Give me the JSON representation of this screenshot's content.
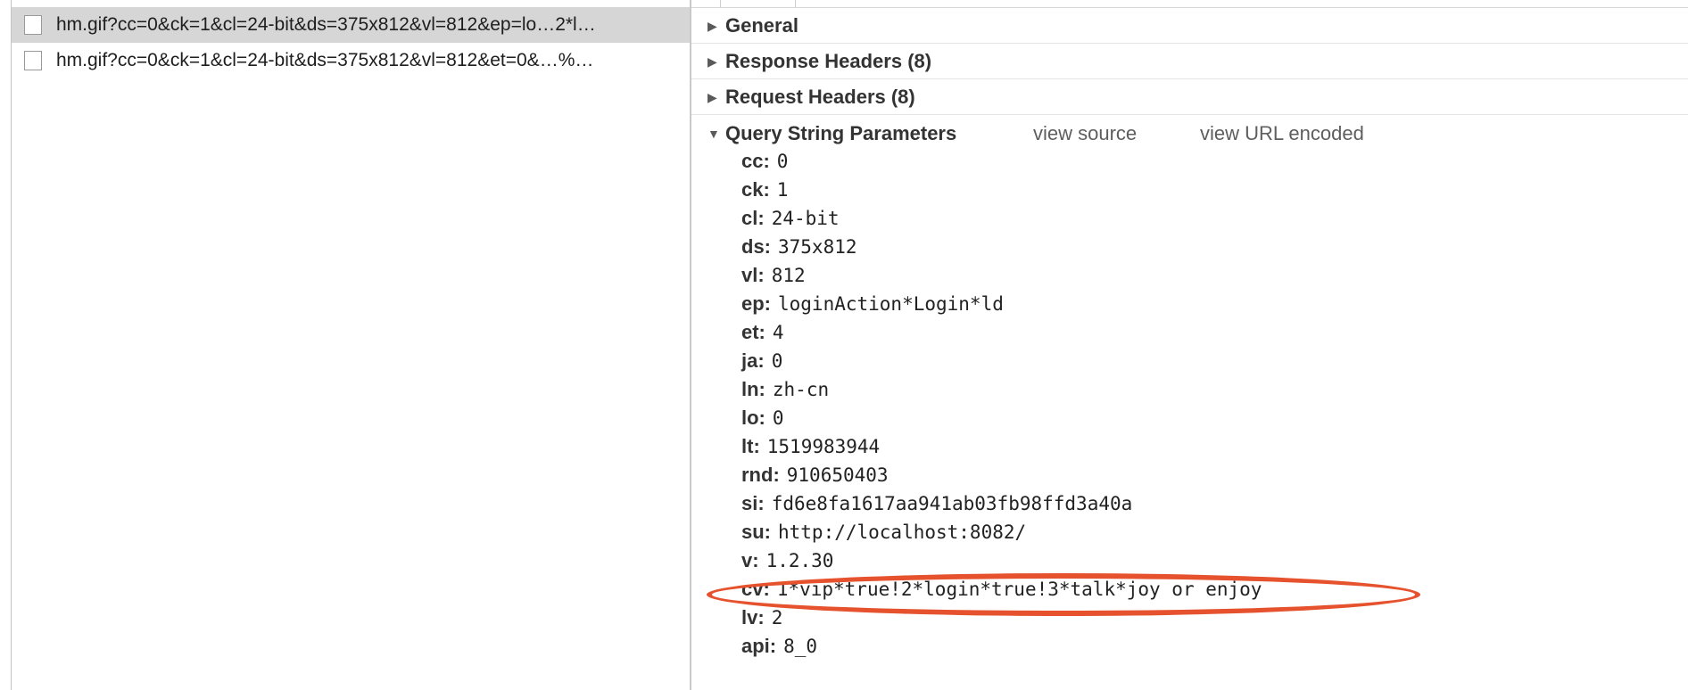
{
  "requests": [
    {
      "name": "hm.gif?cc=0&ck=1&cl=24-bit&ds=375x812&vl=812&ep=lo…2*l…",
      "selected": true
    },
    {
      "name": "hm.gif?cc=0&ck=1&cl=24-bit&ds=375x812&vl=812&et=0&…%…",
      "selected": false
    }
  ],
  "sections": {
    "general": {
      "arrow": "▶",
      "title": "General"
    },
    "response_headers": {
      "arrow": "▶",
      "title": "Response Headers (8)"
    },
    "request_headers": {
      "arrow": "▶",
      "title": "Request Headers (8)"
    },
    "query_string": {
      "arrow": "▼",
      "title": "Query String Parameters",
      "view_source": "view source",
      "view_url_encoded": "view URL encoded"
    }
  },
  "params": [
    {
      "key": "cc:",
      "value": "0"
    },
    {
      "key": "ck:",
      "value": "1"
    },
    {
      "key": "cl:",
      "value": "24-bit"
    },
    {
      "key": "ds:",
      "value": "375x812"
    },
    {
      "key": "vl:",
      "value": "812"
    },
    {
      "key": "ep:",
      "value": "loginAction*Login*ld"
    },
    {
      "key": "et:",
      "value": "4"
    },
    {
      "key": "ja:",
      "value": "0"
    },
    {
      "key": "ln:",
      "value": "zh-cn"
    },
    {
      "key": "lo:",
      "value": "0"
    },
    {
      "key": "lt:",
      "value": "1519983944"
    },
    {
      "key": "rnd:",
      "value": "910650403"
    },
    {
      "key": "si:",
      "value": "fd6e8fa1617aa941ab03fb98ffd3a40a"
    },
    {
      "key": "su:",
      "value": "http://localhost:8082/"
    },
    {
      "key": "v:",
      "value": "1.2.30"
    },
    {
      "key": "cv:",
      "value": "1*vip*true!2*login*true!3*talk*joy or enjoy"
    },
    {
      "key": "lv:",
      "value": "2"
    },
    {
      "key": "api:",
      "value": "8_0"
    }
  ],
  "colors": {
    "selected_row": "#d6d6d6",
    "highlight": "#e5522d"
  }
}
